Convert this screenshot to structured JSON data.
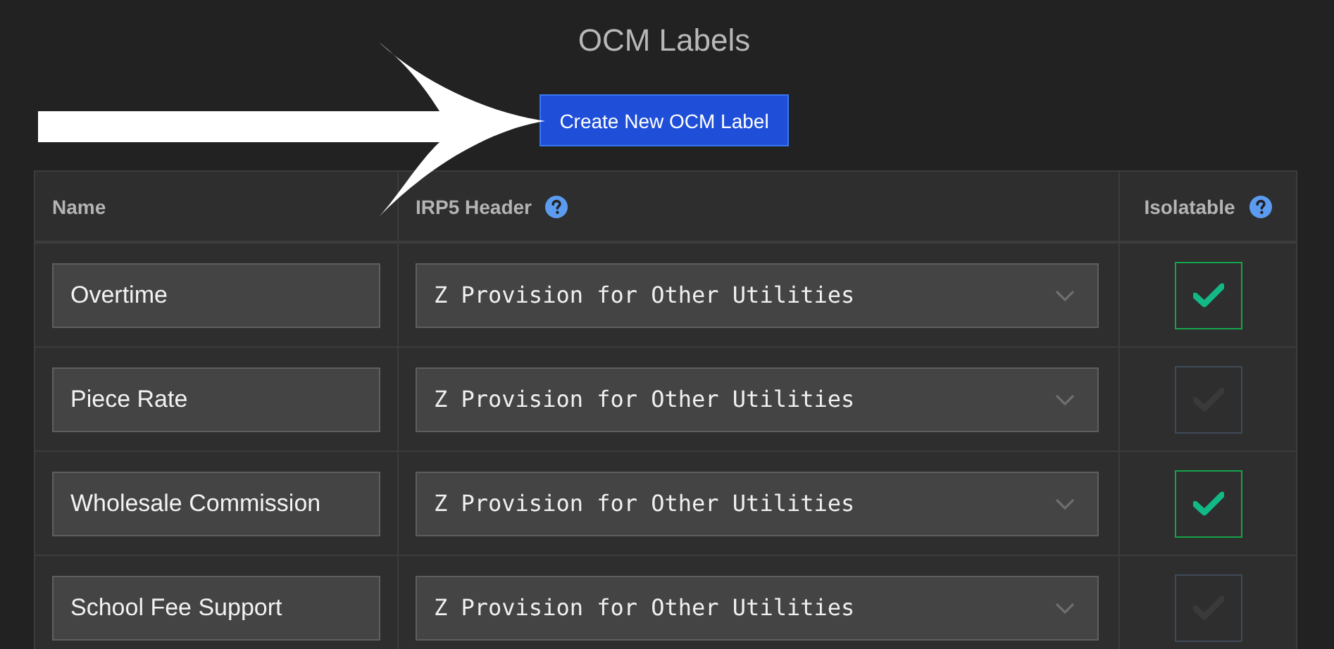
{
  "title": "OCM Labels",
  "create_button": "Create New OCM Label",
  "table": {
    "columns": [
      {
        "label": "Name",
        "kind": "plain"
      },
      {
        "label": "IRP5 Header",
        "kind": "help"
      },
      {
        "label": "Isolatable",
        "kind": "help"
      }
    ],
    "rows": [
      {
        "name": "Overtime",
        "irp5_header": "Z Provision for Other Utilities",
        "isolatable": true
      },
      {
        "name": "Piece Rate",
        "irp5_header": "Z Provision for Other Utilities",
        "isolatable": false
      },
      {
        "name": "Wholesale Commission",
        "irp5_header": "Z Provision for Other Utilities",
        "isolatable": true
      },
      {
        "name": "School Fee Support",
        "irp5_header": "Z Provision for Other Utilities",
        "isolatable": false
      }
    ]
  }
}
